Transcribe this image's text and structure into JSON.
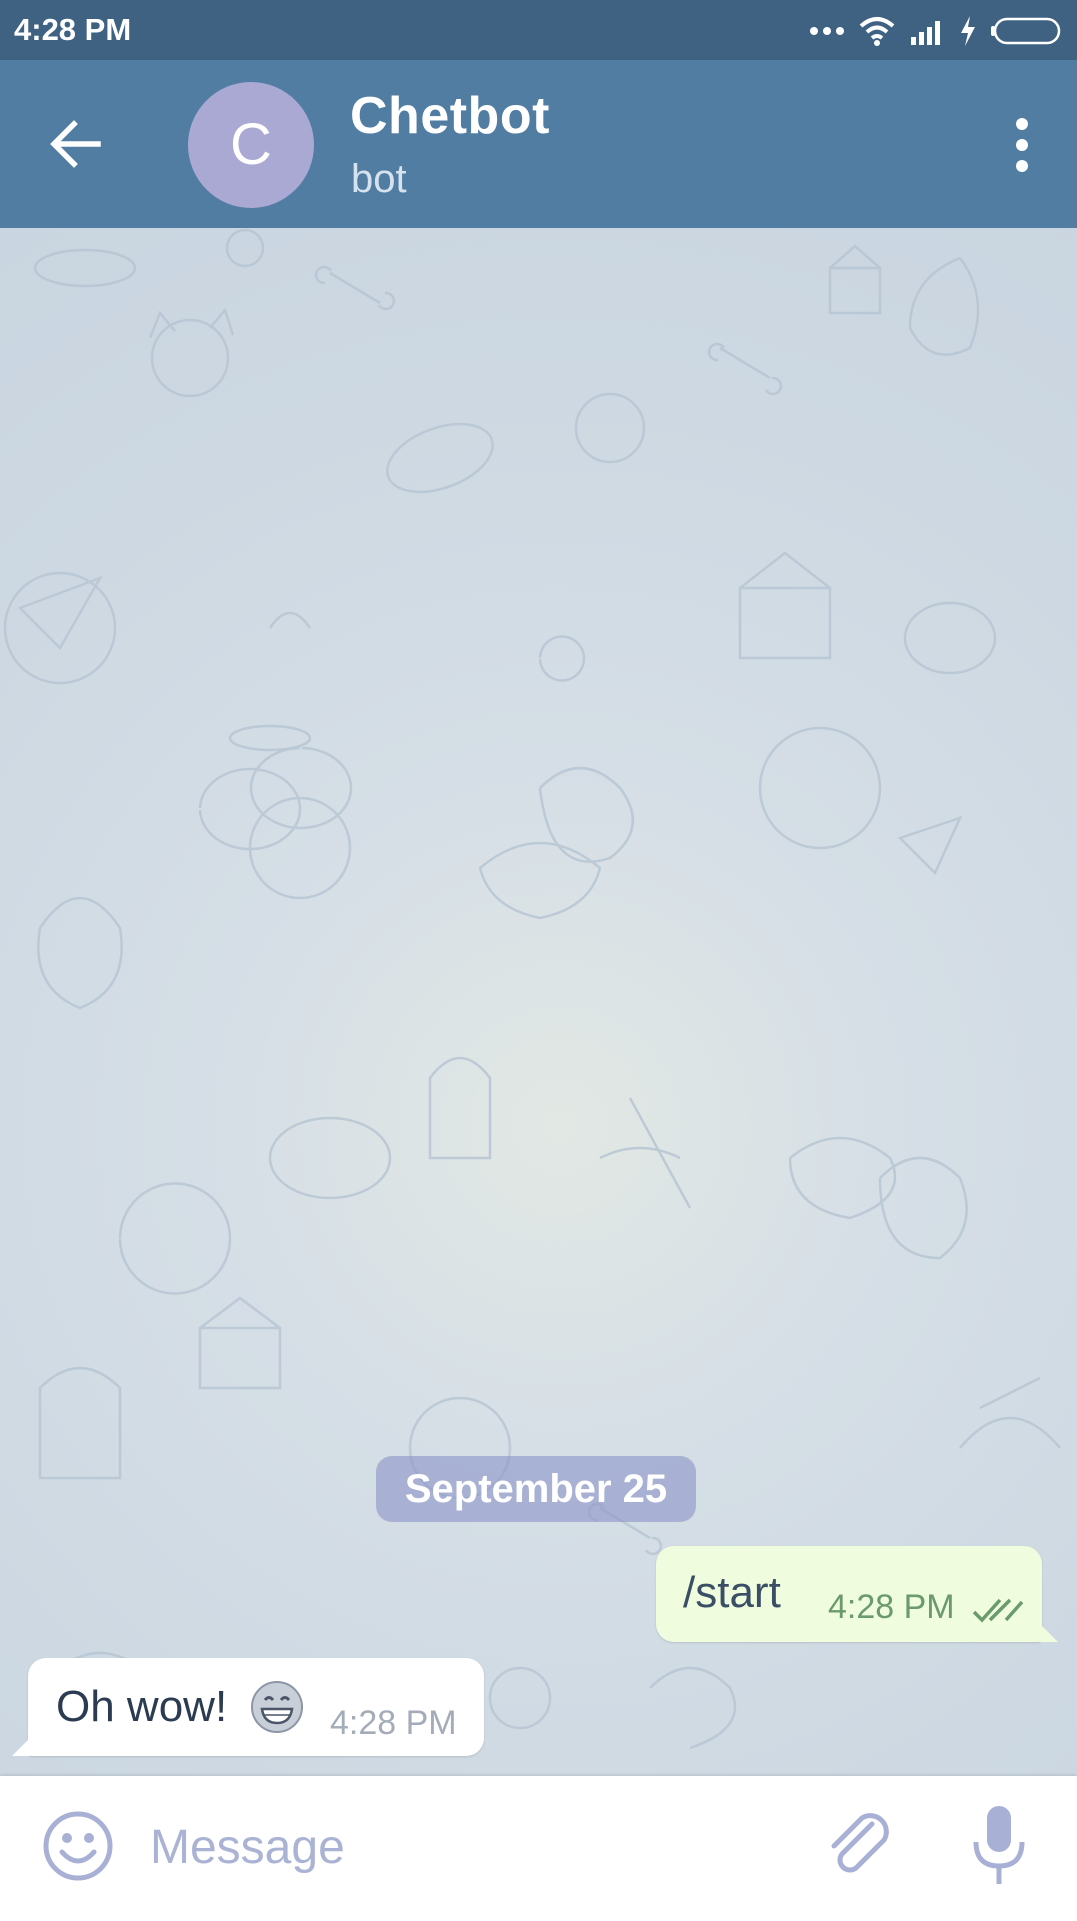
{
  "status_bar": {
    "time": "4:28 PM",
    "icons": [
      "more-dots-icon",
      "wifi-icon",
      "signal-icon",
      "charging-icon",
      "battery-icon"
    ]
  },
  "header": {
    "avatar_letter": "C",
    "title": "Chetbot",
    "subtitle": "bot",
    "icons": {
      "back": "arrow-left-icon",
      "menu": "vertical-dots-icon"
    }
  },
  "chat": {
    "date_badge": "September 25",
    "messages": [
      {
        "direction": "outgoing",
        "text": "/start",
        "time": "4:28 PM",
        "status": "read-double-check"
      },
      {
        "direction": "incoming",
        "text": "Oh wow!",
        "emoji": "grinning-face-icon",
        "time": "4:28 PM"
      }
    ]
  },
  "input": {
    "placeholder": "Message",
    "value": "",
    "icons": {
      "emoji": "smiley-icon",
      "attach": "paperclip-icon",
      "voice": "microphone-icon"
    }
  },
  "colors": {
    "status_bar": "#3f6282",
    "header": "#517da2",
    "avatar": "#a9a9d4",
    "outgoing_bubble": "#effdde",
    "incoming_bubble": "#ffffff",
    "input_icons": "#a9b0d6"
  }
}
